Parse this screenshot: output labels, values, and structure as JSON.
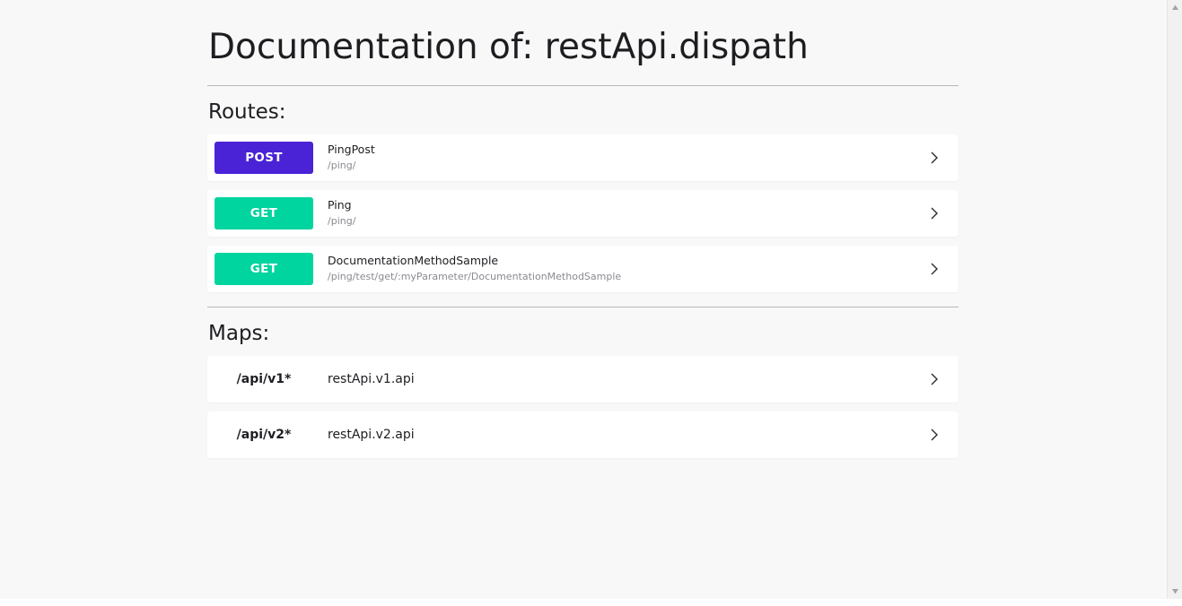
{
  "page": {
    "title": "Documentation of: restApi.dispath"
  },
  "routes": {
    "heading": "Routes:",
    "items": [
      {
        "method": "POST",
        "method_color": "#4a23d6",
        "name": "PingPost",
        "path": "/ping/"
      },
      {
        "method": "GET",
        "method_color": "#00d49f",
        "name": "Ping",
        "path": "/ping/"
      },
      {
        "method": "GET",
        "method_color": "#00d49f",
        "name": "DocumentationMethodSample",
        "path": "/ping/test/get/:myParameter/DocumentationMethodSample"
      }
    ]
  },
  "maps": {
    "heading": "Maps:",
    "items": [
      {
        "prefix": "/api/v1*",
        "target": "restApi.v1.api"
      },
      {
        "prefix": "/api/v2*",
        "target": "restApi.v2.api"
      }
    ]
  },
  "icons": {
    "row_action": "chevron-right-icon",
    "scroll_up": "triangle-up-icon",
    "scroll_down": "triangle-down-icon"
  },
  "colors": {
    "background": "#f8f8f8",
    "card": "#ffffff",
    "text": "#1e1e22",
    "muted": "#8a8a90"
  }
}
